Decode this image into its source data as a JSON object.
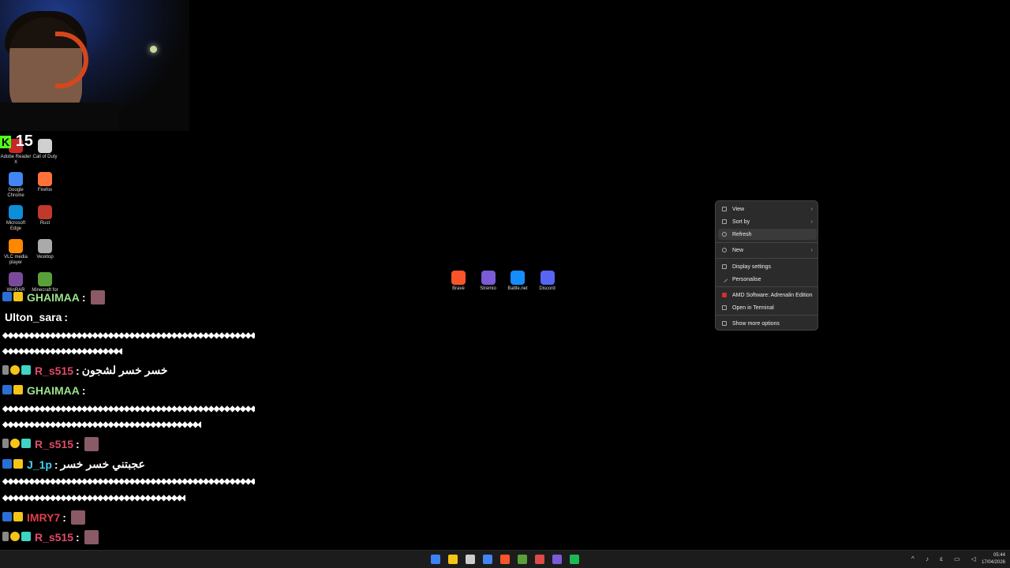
{
  "kick_count": "15",
  "desktop_left": [
    {
      "label": "Adobe Reader X",
      "color": "#c62828"
    },
    {
      "label": "Call of Duty",
      "color": "#d0d0d0"
    },
    {
      "label": "Google Chrome",
      "color": "#4285f4"
    },
    {
      "label": "Firefox",
      "color": "#ff7139"
    },
    {
      "label": "Microsoft Edge",
      "color": "#0c8ed9"
    },
    {
      "label": "Rust",
      "color": "#c0392b"
    },
    {
      "label": "VLC media player",
      "color": "#ff8800"
    },
    {
      "label": "Vesktop",
      "color": "#aaaaaa"
    },
    {
      "label": "WinRAR",
      "color": "#7a4a9a"
    },
    {
      "label": "Minecraft for",
      "color": "#5aa03a"
    }
  ],
  "desktop_center": [
    {
      "label": "Brave",
      "color": "#fb542b"
    },
    {
      "label": "Stremio",
      "color": "#7b5bd6"
    },
    {
      "label": "Battle.net",
      "color": "#148eff"
    },
    {
      "label": "Discord",
      "color": "#5865f2"
    }
  ],
  "chat": [
    {
      "user": "GHAIMAA",
      "color": "#9be28a",
      "message": ""
    },
    {
      "user": "Ulton_sara",
      "color": "#ffffff",
      "message": ""
    },
    {
      "user": "R_s515",
      "color": "#e04a6a",
      "message": "خسر خسر لشجون"
    },
    {
      "user": "GHAIMAA",
      "color": "#9be28a",
      "message": ""
    },
    {
      "user": "R_s515",
      "color": "#e04a6a",
      "message": ""
    },
    {
      "user": "J_1p",
      "color": "#3fd4f4",
      "message": "عجبتني خسر خسر"
    },
    {
      "user": "IMRY7",
      "color": "#e0404a",
      "message": ""
    },
    {
      "user": "R_s515",
      "color": "#e04a6a",
      "message": ""
    },
    {
      "user": "R_s515",
      "color": "#e04a6a",
      "message": ""
    }
  ],
  "squiggle": "◆◆◆◆◆◆◆◆◆◆◆◆◆◆◆◆◆◆◆◆◆◆◆◆◆◆◆◆◆◆◆◆◆◆◆◆◆◆◆◆◆◆◆◆◆◆◆◆◆◆◆◆◆◆◆◆◆◆◆◆◆◆◆◆◆◆◆◆",
  "context_menu": {
    "view": "View",
    "sort_by": "Sort by",
    "refresh": "Refresh",
    "new": "New",
    "display_settings": "Display settings",
    "personalise": "Personalise",
    "amd": "AMD Software: Adrenalin Edition",
    "terminal": "Open in Terminal",
    "more": "Show more options"
  },
  "clock": {
    "time": "05:44",
    "date": "17/04/2026"
  },
  "taskbar_colors": [
    "#3b82f6",
    "#f5c518",
    "#cccccc",
    "#4285f4",
    "#fb542b",
    "#5aa03a",
    "#e04a4a",
    "#7b5bd6",
    "#1db954"
  ]
}
